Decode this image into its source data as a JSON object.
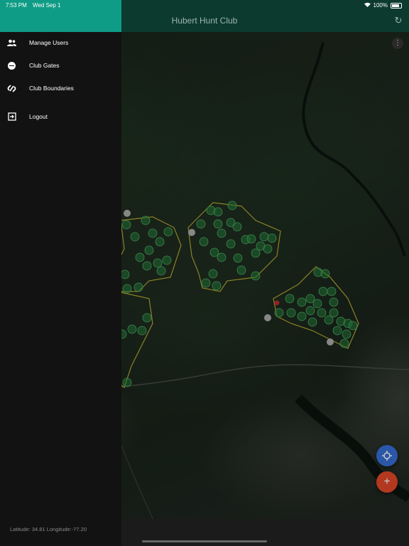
{
  "status_bar": {
    "time": "7:53 PM",
    "date": "Wed Sep 1",
    "battery": "100%"
  },
  "app_bar": {
    "title": "Hubert Hunt Club"
  },
  "drawer": {
    "items": [
      {
        "label": "Manage Users",
        "icon": "users-icon"
      },
      {
        "label": "Club Gates",
        "icon": "gate-icon"
      },
      {
        "label": "Club Boundaries",
        "icon": "boundary-icon"
      },
      {
        "label": "Logout",
        "icon": "logout-icon"
      }
    ]
  },
  "footer": {
    "coordinates": "Latitude: 34.81 Longitude:-77.20"
  },
  "colors": {
    "accent": "#0f9c86",
    "appbar": "#0c3a2f",
    "boundary": "#d4c83a",
    "marker": "#2fa04a",
    "fab_location": "#2b57a8",
    "fab_add": "#b2391f"
  }
}
